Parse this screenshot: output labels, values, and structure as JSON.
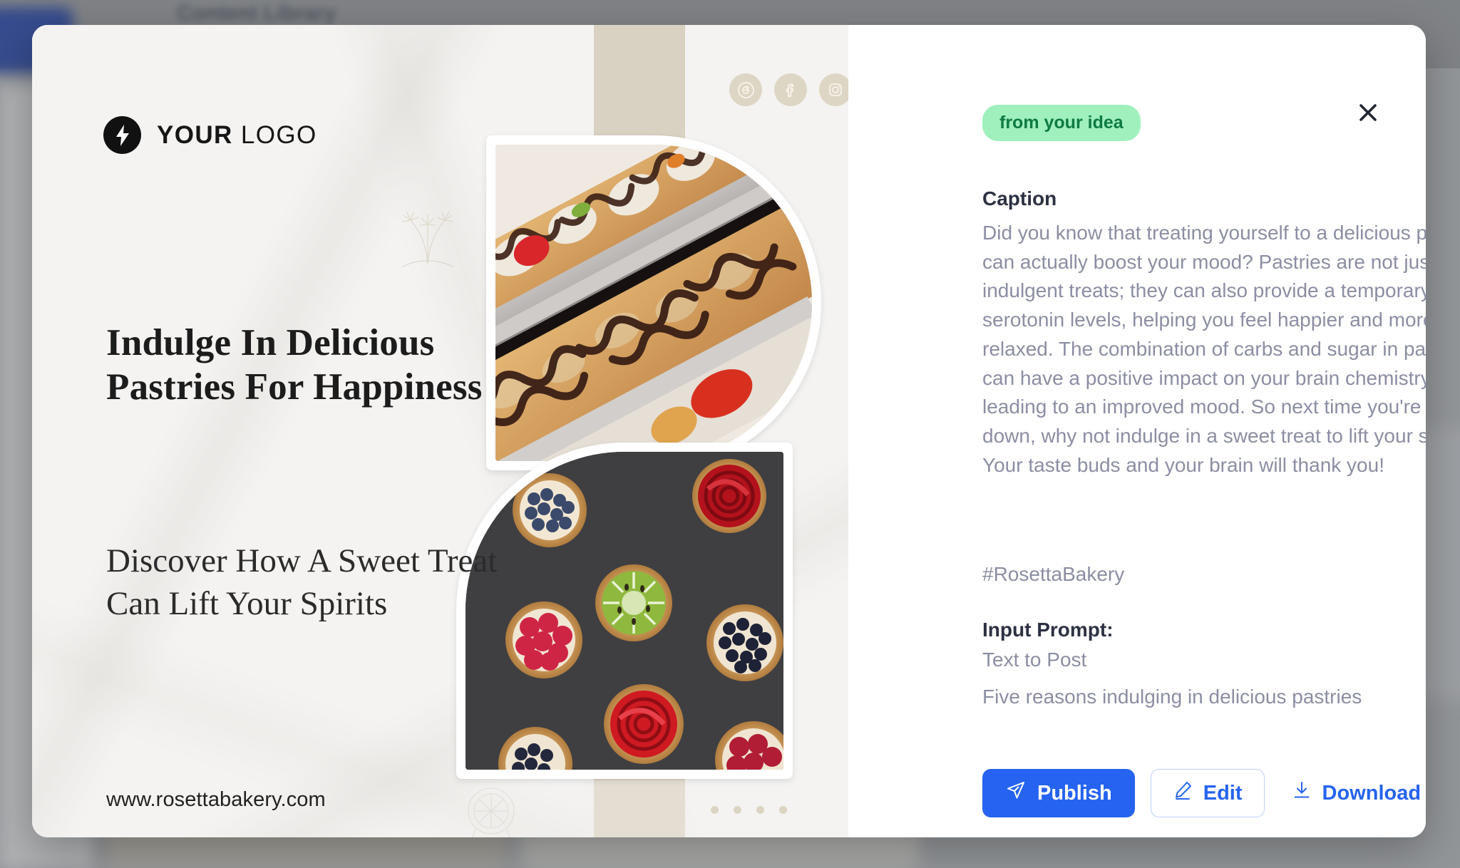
{
  "backdrop": {
    "page_title": "Content Library"
  },
  "poster": {
    "logo": {
      "brand_bold": "YOUR",
      "brand_regular": "LOGO",
      "icon": "lightning-bolt-icon"
    },
    "social": [
      {
        "name": "threads-icon"
      },
      {
        "name": "facebook-icon"
      },
      {
        "name": "instagram-icon"
      }
    ],
    "headline": "Indulge In\nDelicious Pastries\nFor Happiness",
    "subhead": "Discover How A\nSweet Treat Can\nLift Your Spirits",
    "website": "www.rosettabakery.com",
    "photo_1_alt": "chocolate-drizzled-pastries",
    "photo_2_alt": "fruit-tartlets-on-dark-tray",
    "dot_count": 4
  },
  "panel": {
    "badge": "from your idea",
    "close_icon": "close-icon",
    "caption_label": "Caption",
    "caption_body": "Did you know that treating yourself to a delicious pastry can actually boost your mood? Pastries are not just indulgent treats; they can also provide a temporary lift in serotonin levels, helping you feel happier and more relaxed. The combination of carbs and sugar in pastries can have a positive impact on your brain chemistry, leading to an improved mood. So next time you're feeling down, why not indulge in a sweet treat to lift your spirits? Your taste buds and your brain will thank you!",
    "hashtag": "#RosettaBakery",
    "prompt_label": "Input Prompt:",
    "prompt_type": "Text to Post",
    "prompt_text": "Five reasons indulging in delicious pastries",
    "actions": {
      "publish": "Publish",
      "edit": "Edit",
      "download": "Download",
      "more": "•••"
    }
  },
  "colors": {
    "accent_blue": "#2563f0",
    "badge_green_bg": "#9ff0bd",
    "badge_green_text": "#0f7a43",
    "body_text": "#8b8ea3",
    "heading_text": "#2c3142",
    "poster_beige": "#d9d2c2"
  }
}
